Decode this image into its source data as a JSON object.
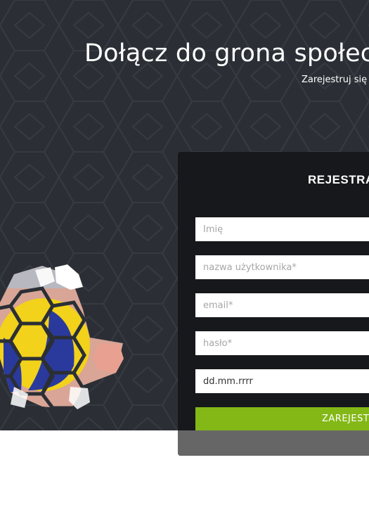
{
  "hero": {
    "title": "Dołącz do grona społecz",
    "subtitle": "Zarejestruj się j"
  },
  "form": {
    "title": "REJESTRA",
    "first_name_placeholder": "Imię",
    "username_placeholder": "nazwa użytkownika*",
    "email_placeholder": "email*",
    "password_placeholder": "hasło*",
    "birthdate_value": "dd.mm.rrrr",
    "submit_label": "ZAREJESTI"
  },
  "colors": {
    "hero_background": "#2b2f35",
    "card_background": "#16181b",
    "accent": "#83b817"
  },
  "icons": {
    "decoration": "volleyball-hexagon-graphic"
  }
}
